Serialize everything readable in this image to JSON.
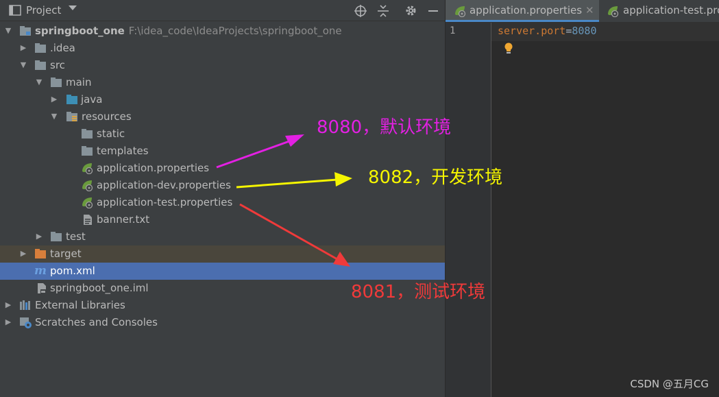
{
  "project_panel": {
    "title": "Project",
    "tree": [
      {
        "label": "springboot_one",
        "path": "F:\\idea_code\\IdeaProjects\\springboot_one",
        "level": 0,
        "expanded": true,
        "icon": "module-folder-icon"
      },
      {
        "label": ".idea",
        "level": 1,
        "expanded": false,
        "icon": "folder-icon"
      },
      {
        "label": "src",
        "level": 1,
        "expanded": true,
        "icon": "folder-icon"
      },
      {
        "label": "main",
        "level": 2,
        "expanded": true,
        "icon": "folder-icon"
      },
      {
        "label": "java",
        "level": 3,
        "expanded": false,
        "icon": "source-folder-icon"
      },
      {
        "label": "resources",
        "level": 3,
        "expanded": true,
        "icon": "resources-folder-icon"
      },
      {
        "label": "static",
        "level": 4,
        "icon": "folder-icon"
      },
      {
        "label": "templates",
        "level": 4,
        "icon": "folder-icon"
      },
      {
        "label": "application.properties",
        "level": 4,
        "icon": "spring-properties-icon"
      },
      {
        "label": "application-dev.properties",
        "level": 4,
        "icon": "spring-properties-icon"
      },
      {
        "label": "application-test.properties",
        "level": 4,
        "icon": "spring-properties-icon"
      },
      {
        "label": "banner.txt",
        "level": 4,
        "icon": "text-file-icon"
      },
      {
        "label": "test",
        "level": 2,
        "expanded": false,
        "icon": "folder-icon"
      },
      {
        "label": "target",
        "level": 1,
        "expanded": false,
        "icon": "excluded-folder-icon"
      },
      {
        "label": "pom.xml",
        "level": 1,
        "icon": "maven-icon",
        "selected": true
      },
      {
        "label": "springboot_one.iml",
        "level": 1,
        "icon": "iml-file-icon"
      },
      {
        "label": "External Libraries",
        "level": 0,
        "expanded": false,
        "icon": "libraries-icon"
      },
      {
        "label": "Scratches and Consoles",
        "level": 0,
        "expanded": false,
        "icon": "scratches-icon"
      }
    ]
  },
  "editor": {
    "tabs": [
      {
        "label": "application.properties",
        "active": true
      },
      {
        "label": "application-test.pro",
        "active": false
      }
    ],
    "line_number": "1",
    "code": {
      "key": "server.port",
      "eq": "=",
      "value": "8080"
    }
  },
  "annotations": [
    {
      "text": "8080，默认环境",
      "color": "#e320e3"
    },
    {
      "text": "8082，开发环境",
      "color": "#f5f500"
    },
    {
      "text": "8081，测试环境",
      "color": "#f03a3a"
    }
  ],
  "watermark": "CSDN @五月CG"
}
